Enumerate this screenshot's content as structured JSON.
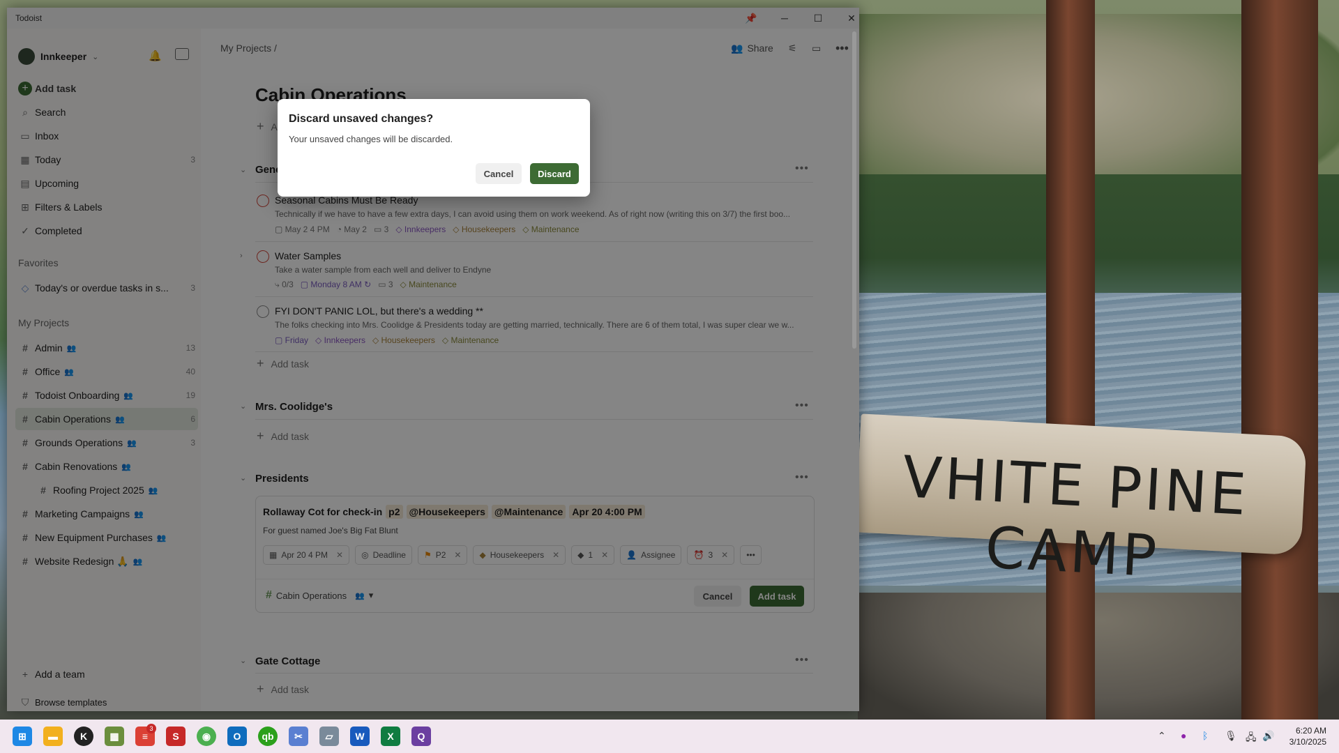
{
  "window": {
    "title": "Todoist"
  },
  "sidebar": {
    "account": "Innkeeper",
    "add_task": "Add task",
    "nav": [
      {
        "label": "Search",
        "count": ""
      },
      {
        "label": "Inbox",
        "count": ""
      },
      {
        "label": "Today",
        "count": "3"
      },
      {
        "label": "Upcoming",
        "count": ""
      },
      {
        "label": "Filters & Labels",
        "count": ""
      },
      {
        "label": "Completed",
        "count": ""
      }
    ],
    "favorites_heading": "Favorites",
    "favorites": [
      {
        "label": "Today's or overdue tasks in s...",
        "count": "3"
      }
    ],
    "projects_heading": "My Projects",
    "projects": [
      {
        "label": "Admin",
        "count": "13"
      },
      {
        "label": "Office",
        "count": "40"
      },
      {
        "label": "Todoist Onboarding",
        "count": "19"
      },
      {
        "label": "Cabin Operations",
        "count": "6"
      },
      {
        "label": "Grounds Operations",
        "count": "3"
      },
      {
        "label": "Cabin Renovations",
        "count": ""
      },
      {
        "label": "Roofing Project 2025",
        "count": ""
      },
      {
        "label": "Marketing Campaigns",
        "count": ""
      },
      {
        "label": "New Equipment Purchases",
        "count": ""
      },
      {
        "label": "Website Redesign 🙏",
        "count": ""
      }
    ],
    "add_team": "Add a team",
    "browse_templates": "Browse templates"
  },
  "header": {
    "breadcrumb": "My Projects /",
    "share": "Share"
  },
  "project": {
    "title": "Cabin Operations",
    "add_task_top": "Add task"
  },
  "sections": {
    "general": {
      "title": "General",
      "tasks": [
        {
          "title": "Seasonal Cabins Must Be Ready",
          "desc": "Technically if we have to have a few extra days, I can avoid using them on work weekend. As of right now (writing this on 3/7) the first boo...",
          "date": "May 2 4 PM",
          "deadline": "May 2",
          "comments": "3",
          "labels": [
            "Innkeepers",
            "Housekeepers",
            "Maintenance"
          ]
        },
        {
          "title": "Water Samples",
          "desc": "Take a water sample from each well and deliver to Endyne",
          "subtasks": "0/3",
          "date": "Monday 8 AM",
          "comments": "3",
          "labels": [
            "Maintenance"
          ]
        },
        {
          "title": "FYI DON'T PANIC LOL, but there's a wedding **",
          "desc": "The folks checking into Mrs. Coolidge & Presidents today are getting married, technically. There are 6 of them total, I was super clear we w...",
          "date": "Friday",
          "labels": [
            "Innkeepers",
            "Housekeepers",
            "Maintenance"
          ]
        }
      ],
      "add_task": "Add task"
    },
    "coolidge": {
      "title": "Mrs. Coolidge's",
      "add_task": "Add task"
    },
    "presidents": {
      "title": "Presidents"
    },
    "gate": {
      "title": "Gate Cottage",
      "add_task": "Add task"
    }
  },
  "editor": {
    "title": "Rollaway Cot for check-in",
    "tokens": [
      "p2",
      "@Housekeepers",
      "@Maintenance",
      "Apr 20 4:00 PM"
    ],
    "description": "For guest named Joe's Big Fat Blunt",
    "chips": {
      "date": "Apr 20 4 PM",
      "deadline": "Deadline",
      "priority": "P2",
      "label": "Housekeepers",
      "reminders": "1",
      "assignee": "Assignee",
      "alarm": "3"
    },
    "project": "Cabin Operations",
    "cancel": "Cancel",
    "submit": "Add task"
  },
  "dialog": {
    "title": "Discard unsaved changes?",
    "body": "Your unsaved changes will be discarded.",
    "cancel": "Cancel",
    "confirm": "Discard"
  },
  "taskbar": {
    "time": "6:20 AM",
    "date": "3/10/2025",
    "badge": "3"
  },
  "wallpaper": {
    "sign_text": "VHITE PINE CAMP"
  },
  "colors": {
    "accent": "#3d6b34",
    "priority1": "#d1453b",
    "date": "#7a5bbf",
    "label": "#a8823a"
  }
}
